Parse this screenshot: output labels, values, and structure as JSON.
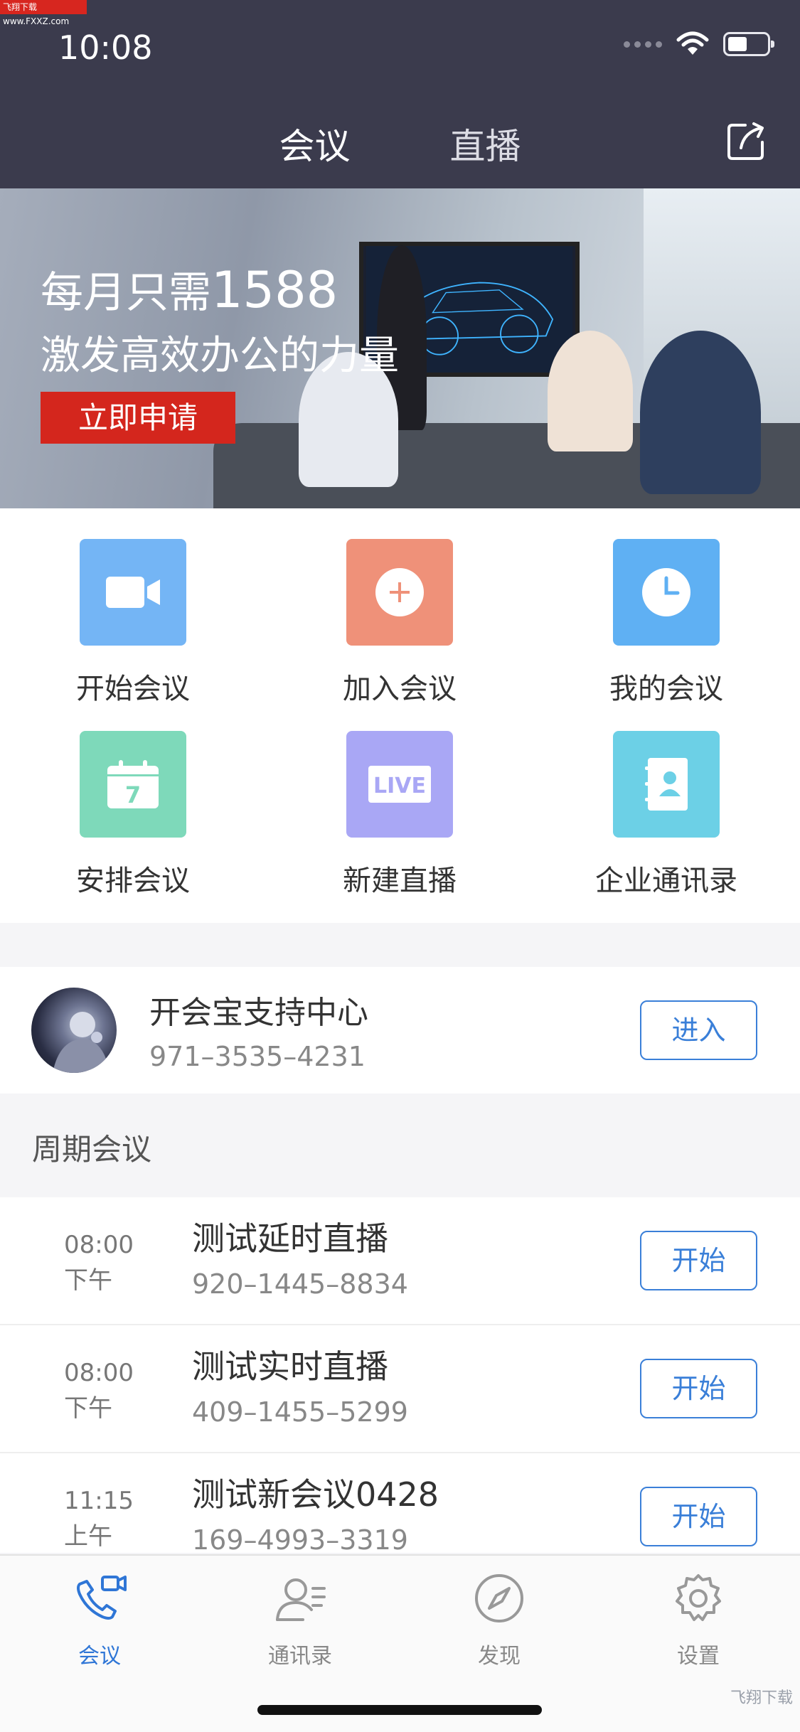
{
  "watermark_top": "飞翔下载 www.FXXZ.com",
  "status": {
    "time": "10:08"
  },
  "header": {
    "tabs": [
      "会议",
      "直播"
    ]
  },
  "banner": {
    "line1_prefix": "每月只需",
    "line1_number": "1588",
    "line2": "激发高效办公的力量",
    "button": "立即申请"
  },
  "grid": [
    {
      "label": "开始会议",
      "icon": "video-camera-icon",
      "color": "#74b5f5"
    },
    {
      "label": "加入会议",
      "icon": "plus-circle-icon",
      "color": "#ef9179"
    },
    {
      "label": "我的会议",
      "icon": "clock-icon",
      "color": "#5fb0f3"
    },
    {
      "label": "安排会议",
      "icon": "calendar-icon",
      "color": "#7ed9ba"
    },
    {
      "label": "新建直播",
      "icon": "live-icon",
      "color": "#a9a7f5"
    },
    {
      "label": "企业通讯录",
      "icon": "contact-book-icon",
      "color": "#6cd0e6"
    }
  ],
  "support": {
    "title": "开会宝支持中心",
    "phone": "971–3535–4231",
    "button": "进入"
  },
  "section_title": "周期会议",
  "meetings": [
    {
      "time": "08:00",
      "period": "下午",
      "title": "测试延时直播",
      "phone": "920–1445–8834",
      "button": "开始"
    },
    {
      "time": "08:00",
      "period": "下午",
      "title": "测试实时直播",
      "phone": "409–1455–5299",
      "button": "开始"
    },
    {
      "time": "11:15",
      "period": "上午",
      "title": "测试新会议0428",
      "phone": "169–4993–3319",
      "button": "开始"
    }
  ],
  "tabbar": [
    {
      "label": "会议",
      "icon": "phone-video-icon",
      "active": true
    },
    {
      "label": "通讯录",
      "icon": "contacts-icon",
      "active": false
    },
    {
      "label": "发现",
      "icon": "compass-icon",
      "active": false
    },
    {
      "label": "设置",
      "icon": "gear-icon",
      "active": false
    }
  ],
  "watermark_bottom": "飞翔下载"
}
